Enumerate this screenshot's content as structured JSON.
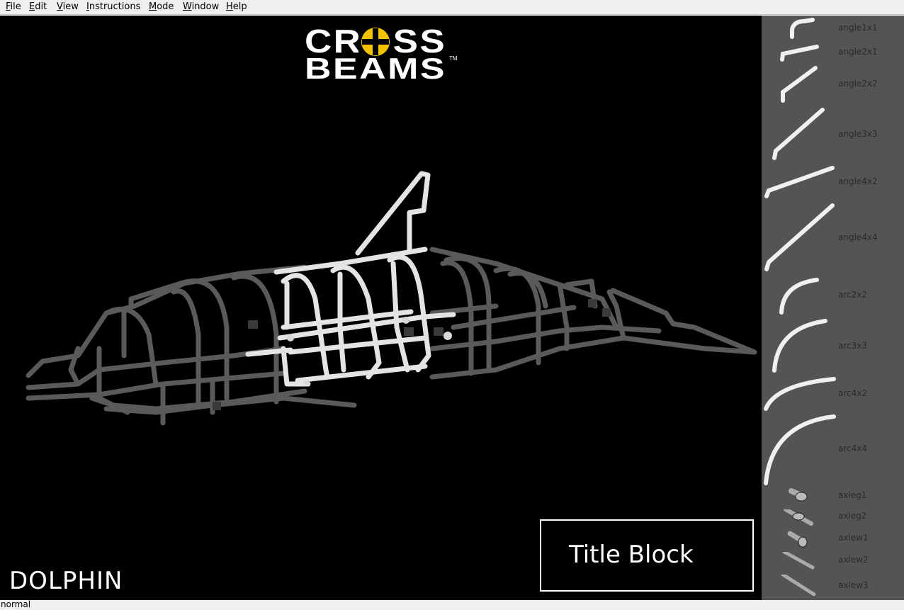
{
  "menu": {
    "items": [
      {
        "mnemonic": "F",
        "rest": "ile"
      },
      {
        "mnemonic": "E",
        "rest": "dit"
      },
      {
        "mnemonic": "V",
        "rest": "iew"
      },
      {
        "mnemonic": "I",
        "rest": "nstructions"
      },
      {
        "mnemonic": "M",
        "rest": "ode"
      },
      {
        "mnemonic": "W",
        "rest": "indow"
      },
      {
        "mnemonic": "H",
        "rest": "elp"
      }
    ]
  },
  "logo": {
    "line1": "CROSS",
    "line2": "BEAMS",
    "accent_color": "#f2c200"
  },
  "viewport": {
    "model_name": "DOLPHIN",
    "title_block": "Title Block",
    "background": "#000000"
  },
  "palette": {
    "items": [
      {
        "label": "angle1x1",
        "icon": "angle-beam-icon"
      },
      {
        "label": "angle2x1",
        "icon": "angle-beam-icon"
      },
      {
        "label": "angle2x2",
        "icon": "angle-beam-icon"
      },
      {
        "label": "angle3x3",
        "icon": "angle-beam-icon"
      },
      {
        "label": "angle4x2",
        "icon": "angle-beam-icon"
      },
      {
        "label": "angle4x4",
        "icon": "angle-beam-icon"
      },
      {
        "label": "arc2x2",
        "icon": "arc-beam-icon"
      },
      {
        "label": "arc3x3",
        "icon": "arc-beam-icon"
      },
      {
        "label": "arc4x2",
        "icon": "arc-beam-icon"
      },
      {
        "label": "arc4x4",
        "icon": "arc-beam-icon"
      },
      {
        "label": "axleg1",
        "icon": "axle-icon"
      },
      {
        "label": "axleg2",
        "icon": "axle-icon"
      },
      {
        "label": "axlew1",
        "icon": "axle-icon"
      },
      {
        "label": "axlew2",
        "icon": "axle-icon"
      },
      {
        "label": "axlew3",
        "icon": "axle-icon"
      }
    ]
  },
  "status": {
    "mode": "normal"
  }
}
